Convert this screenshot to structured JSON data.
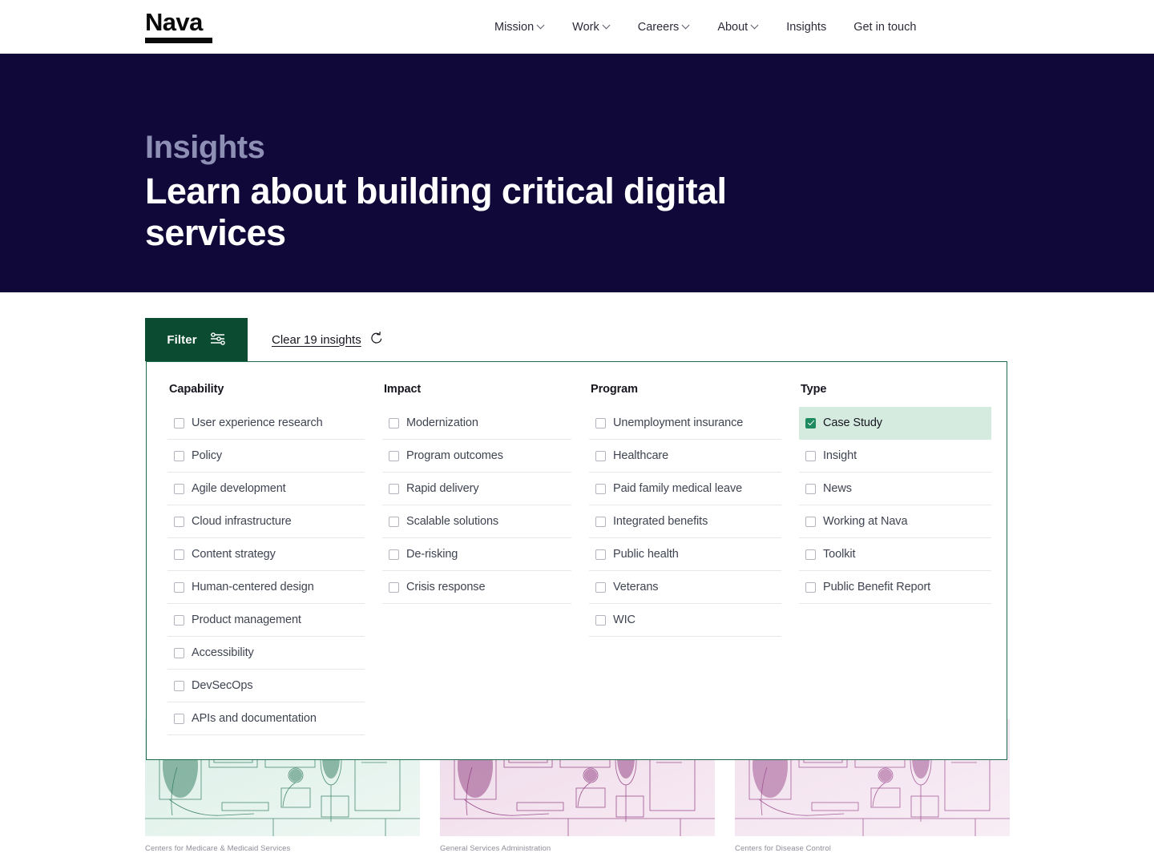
{
  "header": {
    "logo_text": "Nava",
    "nav": [
      {
        "label": "Mission",
        "has_dropdown": true
      },
      {
        "label": "Work",
        "has_dropdown": true
      },
      {
        "label": "Careers",
        "has_dropdown": true
      },
      {
        "label": "About",
        "has_dropdown": true
      },
      {
        "label": "Insights",
        "has_dropdown": false
      },
      {
        "label": "Get in touch",
        "has_dropdown": false
      }
    ]
  },
  "hero": {
    "eyebrow": "Insights",
    "title": "Learn about building critical digital services",
    "background_color": "#100839",
    "eyebrow_color": "#8e8fb4"
  },
  "filter_bar": {
    "filter_label": "Filter",
    "filter_icon": "sliders-icon",
    "filter_button_color": "#0b4b32",
    "clear_label": "Clear 19 insights",
    "clear_icon": "reset-arrow-icon",
    "results_count": 19
  },
  "filter_panel": {
    "border_color": "#1d6a4c",
    "checked_row_background": "#d6ebe0",
    "checkbox_checked_color": "#1e8a5f",
    "columns": [
      {
        "heading": "Capability",
        "options": [
          {
            "label": "User experience research",
            "checked": false
          },
          {
            "label": "Policy",
            "checked": false
          },
          {
            "label": "Agile development",
            "checked": false
          },
          {
            "label": "Cloud infrastructure",
            "checked": false
          },
          {
            "label": "Content strategy",
            "checked": false
          },
          {
            "label": "Human-centered design",
            "checked": false
          },
          {
            "label": "Product management",
            "checked": false
          },
          {
            "label": "Accessibility",
            "checked": false
          },
          {
            "label": "DevSecOps",
            "checked": false
          },
          {
            "label": "APIs and documentation",
            "checked": false
          }
        ]
      },
      {
        "heading": "Impact",
        "options": [
          {
            "label": "Modernization",
            "checked": false
          },
          {
            "label": "Program outcomes",
            "checked": false
          },
          {
            "label": "Rapid delivery",
            "checked": false
          },
          {
            "label": "Scalable solutions",
            "checked": false
          },
          {
            "label": "De-risking",
            "checked": false
          },
          {
            "label": "Crisis response",
            "checked": false
          }
        ]
      },
      {
        "heading": "Program",
        "options": [
          {
            "label": "Unemployment insurance",
            "checked": false
          },
          {
            "label": "Healthcare",
            "checked": false
          },
          {
            "label": "Paid family medical leave",
            "checked": false
          },
          {
            "label": "Integrated benefits",
            "checked": false
          },
          {
            "label": "Public health",
            "checked": false
          },
          {
            "label": "Veterans",
            "checked": false
          },
          {
            "label": "WIC",
            "checked": false
          }
        ]
      },
      {
        "heading": "Type",
        "options": [
          {
            "label": "Case Study",
            "checked": true
          },
          {
            "label": "Insight",
            "checked": false
          },
          {
            "label": "News",
            "checked": false
          },
          {
            "label": "Working at Nava",
            "checked": false
          },
          {
            "label": "Toolkit",
            "checked": false
          },
          {
            "label": "Public Benefit Report",
            "checked": false
          }
        ]
      }
    ]
  },
  "results": {
    "cards": [
      {
        "caption": "Centers for Medicare & Medicaid Services",
        "theme": "teal"
      },
      {
        "caption": "General Services Administration",
        "theme": "plum"
      },
      {
        "caption": "Centers for Disease Control",
        "theme": "plum2"
      }
    ]
  }
}
